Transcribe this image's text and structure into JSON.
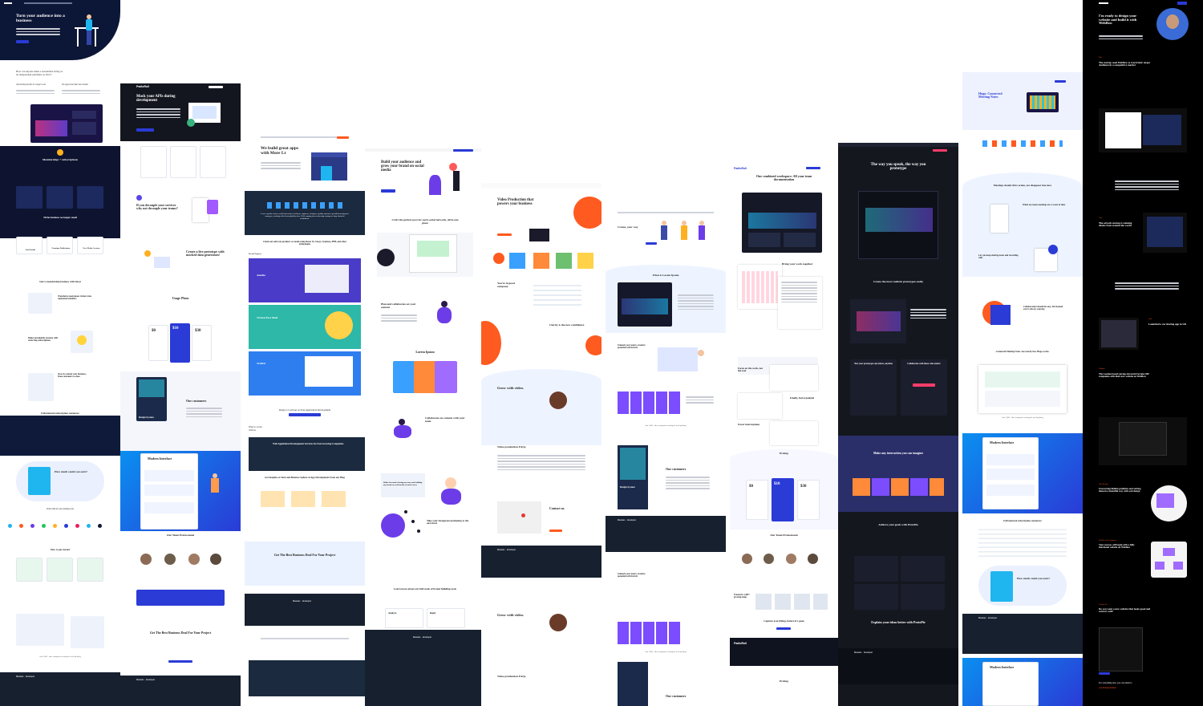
{
  "col1": {
    "hero_title": "Turn your audience into a business",
    "q": "How can anyone make a sustainable living as an independent publisher, in 2021?",
    "f1": "Advertising models no longer work",
    "f2": "We appreciate their user market",
    "mem": "Memberships + subscriptions",
    "niche": "Niche business no longer small",
    "c1": "Paid Emails",
    "c2": "Premium Publications",
    "c3": "New Media Creators",
    "start": "Start a membership business with Ghost",
    "transform": "Transform anonymous visitors into registered members",
    "rev": "Make sustainable revenue with recurring subscriptions",
    "own": "Own & control your business, from customers to data",
    "full": "Full-featured subscription commerce",
    "howmuch": "How much could you earn?",
    "work": "Work with all your existing tools",
    "started": "How to get started",
    "pub": "Join 1,000+ other companies creating the next big thing",
    "brand": "Massiac · developer"
  },
  "col2": {
    "logo": "PadloRoll",
    "hero": "Mock your APIs during development",
    "decouple": "If you decouple your services why not decouple your teams?",
    "proto": "Create a live prototype with mocked data generators!",
    "usage": "Usage Plans",
    "p1": "$0",
    "p2": "$10",
    "p3": "$30",
    "customers": "Our customers",
    "design": "Design System",
    "modern": "Modern Interface",
    "team": "Our Team Professional",
    "deal": "Get The Best Business Deal For Your Project",
    "brand": "Massiac · developer"
  },
  "col3": {
    "hero": "We build great apps with More Lt",
    "lease": "Lease expertise from a world-class team of software engineers, designers, quality assurance specialists and project managers, working with clients globally since 2014, ranging from early-stage startups to large financial institutions.",
    "check": "Check out software products we made using React JS, Vue.js, Symfony, PHP, and other technologies",
    "recent": "Recent Projects",
    "proj1": "Amelia",
    "proj2": "Virtual Post Mail",
    "proj3": "WORX",
    "ready": "Ready to Catch up on Your Application Development",
    "ways": "Ways to work with us",
    "svc": "Web Application Development Services for Fast-Growing Companies",
    "insights": "Get Insights on Tech and Business Sphere of App Development From our Blog",
    "deal": "Get The Best Business Deal For Your Project",
    "brand": "Massiac · developer"
  },
  "col4": {
    "hero": "Build your audience and grow your brand on social media",
    "craft": "Craft the perfect post for each social network, all in one place",
    "plan": "Plan and collaborate on your content",
    "lorem": "Lorem Ipsum",
    "collab": "Collaborate on content with your team",
    "buffer": "Buffer has made sharing my story and building my brand on social media so much easier",
    "insta": "Take your Instagram marketing to the next level",
    "learn": "Learn more about our full stack of brand building tools",
    "analyze": "Analyze",
    "reply": "Reply",
    "brand": "Massiac · developer"
  },
  "col5": {
    "hero": "Video Production that powers your business",
    "good": "You're in good company.",
    "clarity": "Clarity is the new confidence.",
    "grow": "Grow with video.",
    "faq": "Video production FAQs.",
    "contact": "Contact us.",
    "brand": "Massiac · developer"
  },
  "col6": {
    "create": "Create, your way",
    "what": "What is Lorem Ipsum",
    "unleash": "Unleash your team's creative potential with Invtch",
    "join": "Join 1,000+ other companies creating the next big thing",
    "design": "Design System",
    "customers": "Our customers",
    "brand": "Massiac · developer"
  },
  "col7": {
    "logo": "PadloRoll",
    "hero": "One combined workspace. All your team documentation",
    "bring": "Bring your work together",
    "focus": "Focus on the work, not the tool",
    "finally": "Finally, feel organized",
    "fewer": "Fewer interruptions",
    "pricing": "Pricing",
    "p1": "$0",
    "p2": "$10",
    "p3": "$30",
    "team": "Our Team Professional",
    "trusted": "Trusted by 1,000+ growing teams",
    "capture": "Capture everything, before it's gone",
    "brand": "PadloRoll"
  },
  "col8": {
    "hero": "The way you speak, the way you prototype",
    "realistic": "Create the most realistic prototypes easily",
    "test": "Test your prototypes anywhere, anytime",
    "collab": "Collaborate with those who matter",
    "make": "Make any interaction you can imagine",
    "achieve": "Achieve your goals with ProtoPie",
    "explain": "Explain your ideas better with ProtoPie",
    "brand": "Massiac · developer"
  },
  "col9": {
    "hero": "Hugo. Connected Meeting Notes",
    "meetings": "Meetings should drive action, not disappear into docs",
    "need": "When too many meetings are a waste of time",
    "keep": "Let you keep sharing notes and recording calls",
    "collab": "Collaboration should be easy, but instead you're always copying",
    "connected": "Connected Meeting Notes. See exactly how Hugo works.",
    "join": "Join 1,000+ other companies creating the next big thing",
    "modern": "Modern Interface",
    "full": "Full-featured subscription commerce",
    "howmuch": "How much could you earn?",
    "brand": "Massiac · developer"
  },
  "col10": {
    "hero": "I'm ready to design your website and build it with Webflow",
    "hero_link": "Webflow",
    "s1": "The startup used Webflow to reach their target Audience in a competitive market",
    "s2": "The ad tech startup is winning clients from around the world",
    "s3": "Launched a car sharing app in UK",
    "s4": "The London based startup attracted Fortune 500 companies with their new website on Webflow",
    "s5": "Uncovering hidden problems and solving them in a beautiful way with web design",
    "s6": "Your success will begin with a fully functional website on Webflow",
    "contact": "Do you want a new website that looks good and convert well?",
    "email_prompt": "For everything else, you can email to",
    "email": "you.mail@example",
    "tag1": "Rilo",
    "tag2": "Fast",
    "tag3": "Fast",
    "tag4": "Fashion",
    "tag5": "Web Design",
    "tag6": "Webflow Development",
    "tag7": "Contact Us"
  },
  "colors": {
    "navy": "#0f1a3a",
    "blue": "#2a3bd6",
    "cyan": "#1fb6f0",
    "orange": "#ff5a1f",
    "purple": "#6c3ce8",
    "dark": "#16171c",
    "footer": "#17202f"
  }
}
